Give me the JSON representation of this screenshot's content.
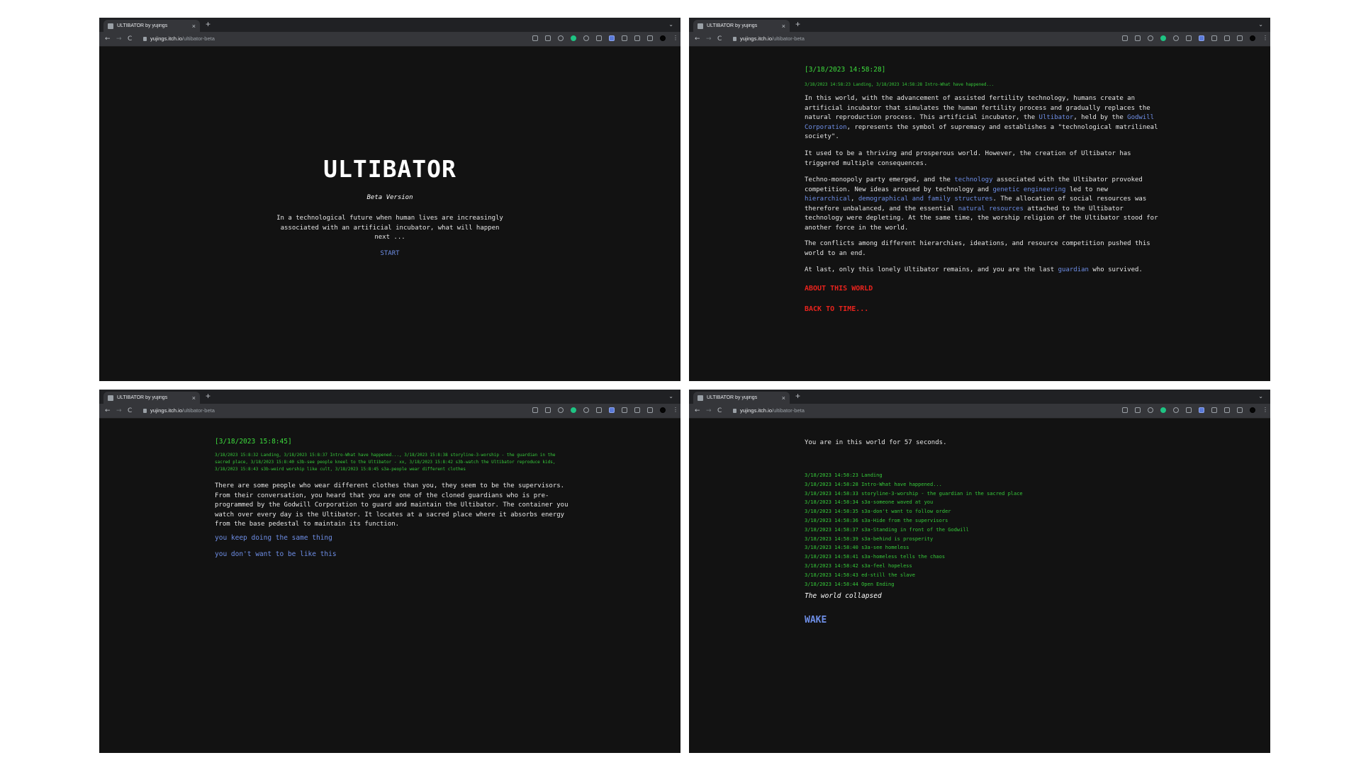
{
  "browser": {
    "tab_title": "ULTIBATOR by yujings",
    "tab_close": "×",
    "new_tab": "+",
    "tab_menu": "⌄",
    "back": "←",
    "forward": "→",
    "reload": "C",
    "url_host": "yujings.itch.io",
    "url_path": "/ultibator-beta",
    "toolbar_icons": [
      "translate-icon",
      "share-icon",
      "star-icon",
      "grammarly-icon",
      "dots-icon",
      "circle-icon",
      "extension-icon",
      "photo-icon",
      "puzzle-icon",
      "reading-list-icon",
      "sidepanel-icon",
      "profile-icon",
      "menu-icon"
    ]
  },
  "colors": {
    "background": "#121212",
    "log_green": "#36c93a",
    "link_blue": "#6e8ee6",
    "alert_red": "#e8231d"
  },
  "start_screen": {
    "title": "ULTIBATOR",
    "subtitle": "Beta Version",
    "description": "In a technological future when human lives are increasingly associated with an artificial incubator, what will happen next ...",
    "start_label": "START"
  },
  "intro_screen": {
    "timestamp": "[3/18/2023 14:58:28]",
    "log": "3/18/2023 14:58:23 Landing, 3/18/2023 14:58:28 Intro-What have happened...",
    "p1": {
      "a": "In this world, with the advancement of assisted fertility technology, humans create an artificial incubator that simulates the human fertility process and gradually replaces the natural reproduction process. This artificial incubator, the ",
      "k1": "Ultibator",
      "b": ", held by the ",
      "k2": "Godwill Corporation",
      "c": ", represents the symbol of supremacy and establishes a \"technological matrilineal society\"."
    },
    "p2": "It used to be a thriving and prosperous world. However, the creation of Ultibator has triggered multiple consequences.",
    "p3": {
      "a": "Techno-monopoly party emerged, and the ",
      "k1": "technology",
      "b": " associated with the Ultibator provoked competition. New ideas aroused by technology and ",
      "k2": "genetic engineering",
      "c": " led to new ",
      "k3": "hierarchical",
      "d": ", ",
      "k4": "demographical and family structures",
      "e": ". The allocation of social resources was therefore unbalanced, and the essential ",
      "k5": "natural resources",
      "f": " attached to the Ultibator technology were depleting. At the same time, the worship religion of the Ultibator stood for another force in the world."
    },
    "p4": "The conflicts among different hierarchies, ideations, and resource competition pushed this world to an end.",
    "p5": {
      "a": "At last, only this lonely Ultibator remains, and you are the last ",
      "k1": "guardian",
      "b": " who survived."
    },
    "about_link": "ABOUT THIS WORLD",
    "back_link": "BACK TO TIME..."
  },
  "story_screen": {
    "timestamp": "[3/18/2023 15:8:45]",
    "log": "3/18/2023 15:8:32 Landing, 3/18/2023 15:8:37 Intro-What have happened..., 3/18/2023 15:8:38 storyline-3-worship - the guardian in the sacred place, 3/18/2023 15:8:40 s3b-see people kneel to the Ultibator - xx, 3/18/2023 15:8:42 s3b-watch the Ultibator reproduce kids, 3/18/2023 15:8:43 s3b-weird worship like cult, 3/18/2023 15:8:45 s3a-people wear different clothes",
    "paragraph": "There are some people who wear different clothes than you, they seem to be the supervisors. From their conversation, you heard that you are one of the cloned guardians who is pre-programmed by the Godwill Corporation to guard and maintain the Ultibator. The container you watch over every day is the Ultibator. It locates at a sacred place where it absorbs energy from the base pedestal to maintain its function.",
    "choice1": "you keep doing the same thing",
    "choice2": "you don't want to be like this"
  },
  "ending_screen": {
    "duration_text": "You are in this world for 57 seconds.",
    "log_entries": [
      "3/18/2023 14:58:23 Landing",
      "3/18/2023 14:58:28 Intro-What have happened...",
      "3/18/2023 14:58:33 storyline-3-worship - the guardian in the sacred place",
      "3/18/2023 14:58:34 s3a-someone waved at you",
      "3/18/2023 14:58:35 s3a-don't want to follow order",
      "3/18/2023 14:58:36 s3a-Hide from the supervisors",
      "3/18/2023 14:58:37 s3a-Standing in front of the Godwill",
      "3/18/2023 14:58:39 s3a-behind is prosperity",
      "3/18/2023 14:58:40 s3a-see homeless",
      "3/18/2023 14:58:41 s3a-homeless tells the chaos",
      "3/18/2023 14:58:42 s3a-feel hopeless",
      "3/18/2023 14:58:43 ed-still the slave",
      "3/18/2023 14:58:44 Open Ending"
    ],
    "collapsed_text": "The world collapsed",
    "wake_label": "WAKE"
  }
}
